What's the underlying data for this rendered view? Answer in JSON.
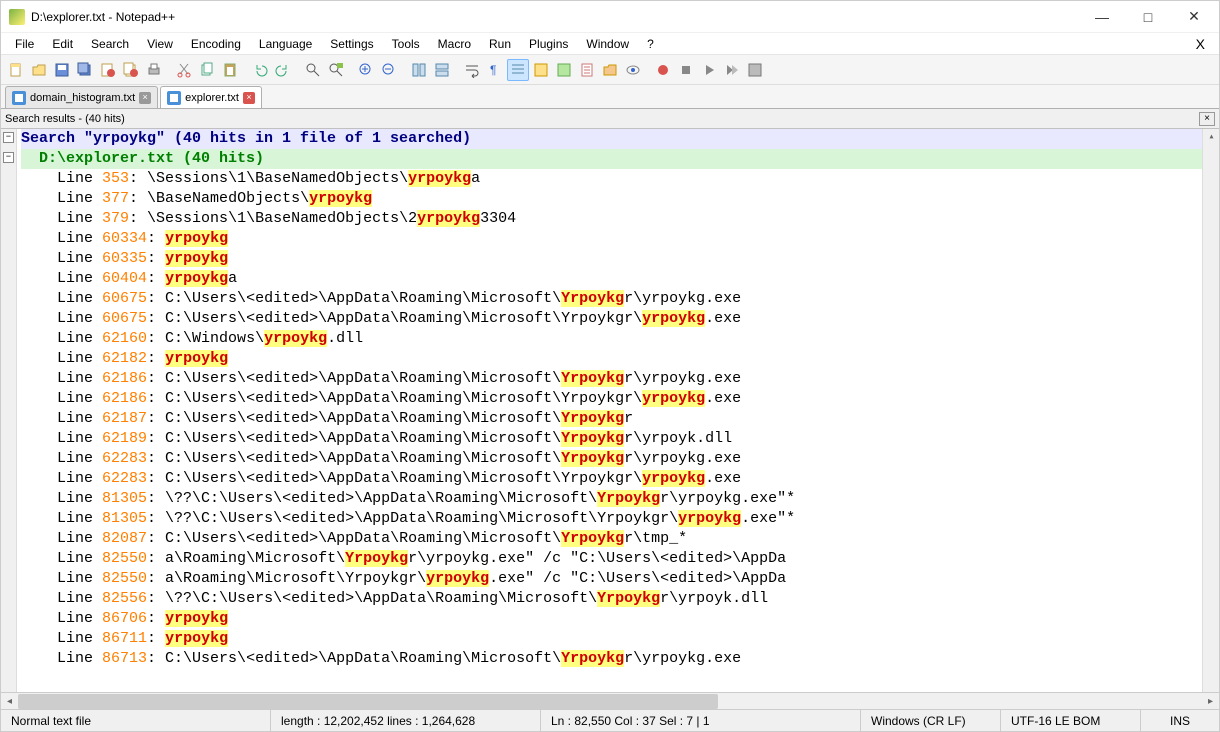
{
  "window": {
    "title": "D:\\explorer.txt - Notepad++"
  },
  "menu": [
    "File",
    "Edit",
    "Search",
    "View",
    "Encoding",
    "Language",
    "Settings",
    "Tools",
    "Macro",
    "Run",
    "Plugins",
    "Window",
    "?"
  ],
  "tabs": [
    {
      "label": "domain_histogram.txt",
      "active": false
    },
    {
      "label": "explorer.txt",
      "active": true
    }
  ],
  "search_panel_title": "Search results - (40 hits)",
  "search_header": "Search \"yrpoykg\" (40 hits in 1 file of 1 searched)",
  "file_header": "  D:\\explorer.txt (40 hits)",
  "results": [
    {
      "ln": "353",
      "pre": "\\Sessions\\1\\BaseNamedObjects\\",
      "m": "yrpoykg",
      "post": "a"
    },
    {
      "ln": "377",
      "pre": "\\BaseNamedObjects\\",
      "m": "yrpoykg",
      "post": ""
    },
    {
      "ln": "379",
      "pre": "\\Sessions\\1\\BaseNamedObjects\\2",
      "m": "yrpoykg",
      "post": "3304"
    },
    {
      "ln": "60334",
      "pre": "",
      "m": "yrpoykg",
      "post": ""
    },
    {
      "ln": "60335",
      "pre": "",
      "m": "yrpoykg",
      "post": ""
    },
    {
      "ln": "60404",
      "pre": "",
      "m": "yrpoykg",
      "post": "a"
    },
    {
      "ln": "60675",
      "pre": "C:\\Users\\<edited>\\AppData\\Roaming\\Microsoft\\",
      "m": "Yrpoykg",
      "post": "r\\yrpoykg.exe"
    },
    {
      "ln": "60675",
      "pre": "C:\\Users\\<edited>\\AppData\\Roaming\\Microsoft\\Yrpoykgr\\",
      "m": "yrpoykg",
      "post": ".exe"
    },
    {
      "ln": "62160",
      "pre": "C:\\Windows\\",
      "m": "yrpoykg",
      "post": ".dll"
    },
    {
      "ln": "62182",
      "pre": "",
      "m": "yrpoykg",
      "post": ""
    },
    {
      "ln": "62186",
      "pre": "C:\\Users\\<edited>\\AppData\\Roaming\\Microsoft\\",
      "m": "Yrpoykg",
      "post": "r\\yrpoykg.exe"
    },
    {
      "ln": "62186",
      "pre": "C:\\Users\\<edited>\\AppData\\Roaming\\Microsoft\\Yrpoykgr\\",
      "m": "yrpoykg",
      "post": ".exe"
    },
    {
      "ln": "62187",
      "pre": "C:\\Users\\<edited>\\AppData\\Roaming\\Microsoft\\",
      "m": "Yrpoykg",
      "post": "r"
    },
    {
      "ln": "62189",
      "pre": "C:\\Users\\<edited>\\AppData\\Roaming\\Microsoft\\",
      "m": "Yrpoykg",
      "post": "r\\yrpoyk.dll"
    },
    {
      "ln": "62283",
      "pre": "C:\\Users\\<edited>\\AppData\\Roaming\\Microsoft\\",
      "m": "Yrpoykg",
      "post": "r\\yrpoykg.exe"
    },
    {
      "ln": "62283",
      "pre": "C:\\Users\\<edited>\\AppData\\Roaming\\Microsoft\\Yrpoykgr\\",
      "m": "yrpoykg",
      "post": ".exe"
    },
    {
      "ln": "81305",
      "pre": "\\??\\C:\\Users\\<edited>\\AppData\\Roaming\\Microsoft\\",
      "m": "Yrpoykg",
      "post": "r\\yrpoykg.exe\"*"
    },
    {
      "ln": "81305",
      "pre": "\\??\\C:\\Users\\<edited>\\AppData\\Roaming\\Microsoft\\Yrpoykgr\\",
      "m": "yrpoykg",
      "post": ".exe\"*"
    },
    {
      "ln": "82087",
      "pre": "C:\\Users\\<edited>\\AppData\\Roaming\\Microsoft\\",
      "m": "Yrpoykg",
      "post": "r\\tmp_*"
    },
    {
      "ln": "82550",
      "pre": "a\\Roaming\\Microsoft\\",
      "m": "Yrpoykg",
      "post": "r\\yrpoykg.exe\" /c \"C:\\Users\\<edited>\\AppDa"
    },
    {
      "ln": "82550",
      "pre": "a\\Roaming\\Microsoft\\Yrpoykgr\\",
      "m": "yrpoykg",
      "post": ".exe\" /c \"C:\\Users\\<edited>\\AppDa"
    },
    {
      "ln": "82556",
      "pre": "\\??\\C:\\Users\\<edited>\\AppData\\Roaming\\Microsoft\\",
      "m": "Yrpoykg",
      "post": "r\\yrpoyk.dll"
    },
    {
      "ln": "86706",
      "pre": "",
      "m": "yrpoykg",
      "post": ""
    },
    {
      "ln": "86711",
      "pre": "",
      "m": "yrpoykg",
      "post": ""
    },
    {
      "ln": "86713",
      "pre": "C:\\Users\\<edited>\\AppData\\Roaming\\Microsoft\\",
      "m": "Yrpoykg",
      "post": "r\\yrpoykg.exe"
    }
  ],
  "status": {
    "filetype": "Normal text file",
    "length": "length : 12,202,452    lines : 1,264,628",
    "pos": "Ln : 82,550    Col : 37    Sel : 7 | 1",
    "eol": "Windows (CR LF)",
    "enc": "UTF-16 LE BOM",
    "ovr": "INS"
  }
}
